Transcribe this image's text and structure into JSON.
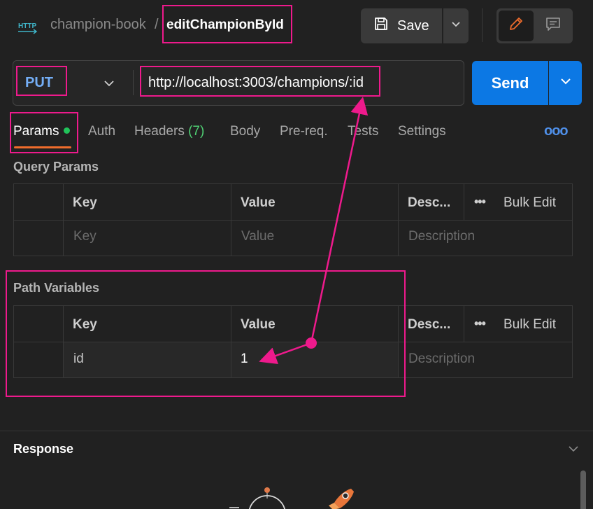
{
  "header": {
    "http_icon_label": "HTTP",
    "breadcrumb_parent": "champion-book",
    "breadcrumb_separator": "/",
    "request_name": "editChampionById",
    "save_label": "Save"
  },
  "request": {
    "method": "PUT",
    "url": "http://localhost:3003/champions/:id",
    "send_label": "Send"
  },
  "tabs": [
    {
      "label": "Params",
      "active": true
    },
    {
      "label": "Auth"
    },
    {
      "label": "Headers",
      "count": "(7)"
    },
    {
      "label": "Body"
    },
    {
      "label": "Pre-req."
    },
    {
      "label": "Tests"
    },
    {
      "label": "Settings"
    }
  ],
  "more_label": "ooo",
  "query_params": {
    "title": "Query Params",
    "columns": [
      "Key",
      "Value",
      "Desc..."
    ],
    "bulk_edit_label": "Bulk Edit",
    "bulk_dots": "•••",
    "placeholder_row": {
      "key": "Key",
      "value": "Value",
      "description": "Description"
    }
  },
  "path_variables": {
    "title": "Path Variables",
    "columns": [
      "Key",
      "Value",
      "Desc..."
    ],
    "bulk_edit_label": "Bulk Edit",
    "bulk_dots": "•••",
    "rows": [
      {
        "key": "id",
        "value": "1",
        "description": "Description"
      }
    ]
  },
  "response": {
    "title": "Response"
  },
  "colors": {
    "accent_send": "#0c78e4",
    "method_color": "#74aef6",
    "annotation": "#ee1a8c",
    "active_tab_underline": "#ef6c2c",
    "params_dot": "#21c35a",
    "headers_count": "#4fcf73"
  },
  "icons": {
    "http": "http-icon",
    "save": "save-icon",
    "chevron": "chevron-down-icon",
    "edit": "pencil-icon",
    "comment": "comment-icon",
    "rocket": "rocket-icon",
    "astronaut": "astronaut-icon"
  }
}
